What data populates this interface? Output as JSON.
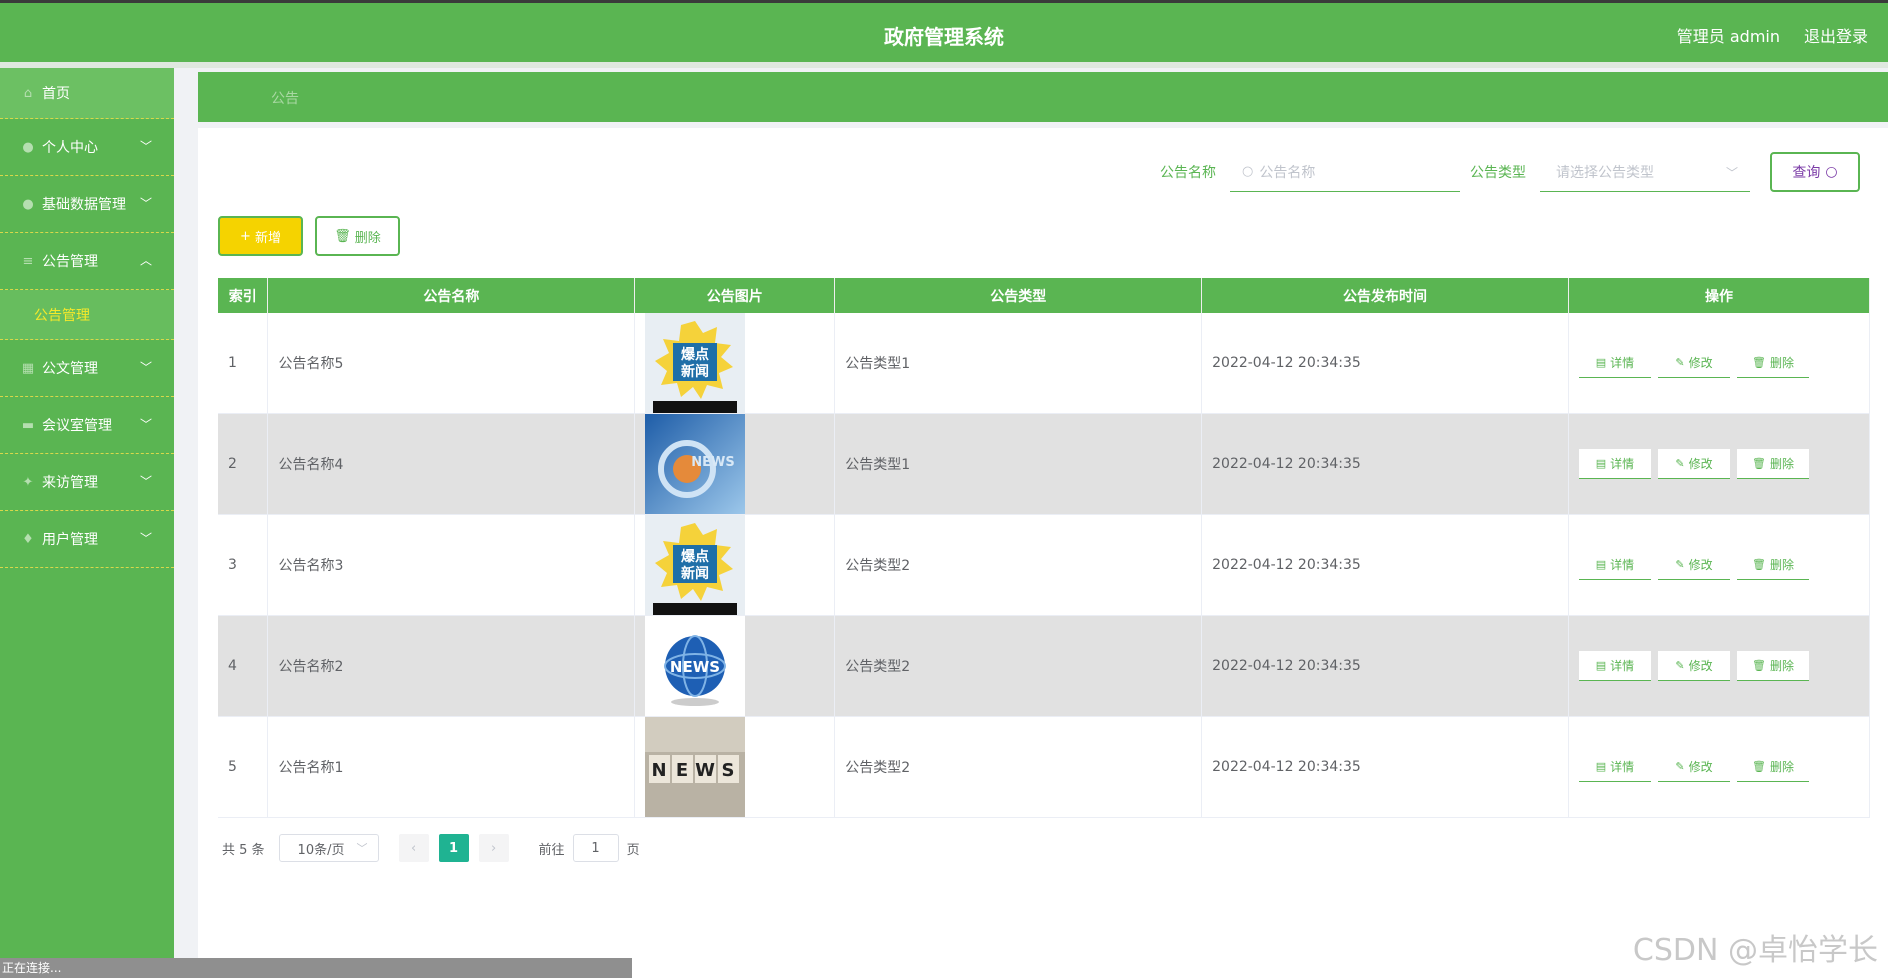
{
  "header": {
    "title": "政府管理系统",
    "user": "管理员 admin",
    "logout": "退出登录"
  },
  "sidebar": {
    "items": [
      {
        "label": "首页",
        "icon": "home-icon"
      },
      {
        "label": "个人中心",
        "icon": "user-icon"
      },
      {
        "label": "基础数据管理",
        "icon": "user-icon"
      },
      {
        "label": "公告管理",
        "icon": "menu-icon",
        "expanded": true,
        "sub": "公告管理"
      },
      {
        "label": "公文管理",
        "icon": "grid-icon"
      },
      {
        "label": "会议室管理",
        "icon": "keyboard-icon"
      },
      {
        "label": "来访管理",
        "icon": "pin-icon"
      },
      {
        "label": "用户管理",
        "icon": "location-icon"
      }
    ]
  },
  "breadcrumb": "公告",
  "search": {
    "name_label": "公告名称",
    "name_placeholder": "公告名称",
    "type_label": "公告类型",
    "type_placeholder": "请选择公告类型",
    "query_label": "查询"
  },
  "toolbar": {
    "add_label": "新增",
    "delete_label": "删除"
  },
  "table": {
    "columns": [
      "索引",
      "公告名称",
      "公告图片",
      "公告类型",
      "公告发布时间",
      "操作"
    ],
    "rows": [
      {
        "index": "1",
        "name": "公告名称5",
        "image": "baodian",
        "type": "公告类型1",
        "time": "2022-04-12 20:34:35"
      },
      {
        "index": "2",
        "name": "公告名称4",
        "image": "news-blue",
        "type": "公告类型1",
        "time": "2022-04-12 20:34:35"
      },
      {
        "index": "3",
        "name": "公告名称3",
        "image": "baodian",
        "type": "公告类型2",
        "time": "2022-04-12 20:34:35"
      },
      {
        "index": "4",
        "name": "公告名称2",
        "image": "news-globe",
        "type": "公告类型2",
        "time": "2022-04-12 20:34:35"
      },
      {
        "index": "5",
        "name": "公告名称1",
        "image": "news-blocks",
        "type": "公告类型2",
        "time": "2022-04-12 20:34:35"
      }
    ],
    "actions": {
      "detail": "详情",
      "edit": "修改",
      "delete": "删除"
    }
  },
  "pager": {
    "total": "共 5 条",
    "page_size": "10条/页",
    "current": "1",
    "goto_label": "前往",
    "goto_value": "1",
    "page_suffix": "页"
  },
  "status": "正在连接...",
  "watermark": "CSDN @卓怡学长",
  "colors": {
    "primary": "#5ab552",
    "add_button": "#f5d300",
    "active_page": "#1fb392",
    "submenu_active": "#f5e92a"
  }
}
